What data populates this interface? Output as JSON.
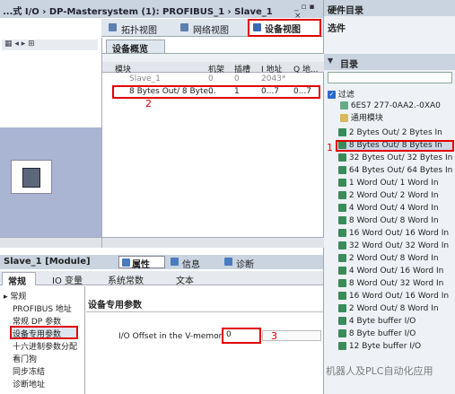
{
  "left_title": "...式 I/O  ›  DP-Mastersystem (1): PROFIBUS_1  ›  Slave_1",
  "win_ctrl": "_ ▫ ▪ ×",
  "view_tabs": [
    "拓扑视图",
    "网络视图",
    "设备视图"
  ],
  "overview_tab": "设备概览",
  "cols": [
    "模块",
    "机架",
    "插槽",
    "I 地址",
    "Q 地..."
  ],
  "rows": [
    {
      "module": "Slave_1",
      "rack": "0",
      "slot": "0",
      "i": "2043*",
      "q": ""
    },
    {
      "module": "8 Bytes Out/ 8 Byte...",
      "rack": "0",
      "slot": "1",
      "i": "0...7",
      "q": "0...7"
    }
  ],
  "marks": [
    "1",
    "2",
    "3"
  ],
  "module_title": "Slave_1 [Module]",
  "prop_tabs": [
    "属性",
    "信息",
    "诊断"
  ],
  "sub_tabs": [
    "常规",
    "IO 变量",
    "系统常数",
    "文本"
  ],
  "nav": [
    "▸ 常规",
    "PROFIBUS 地址",
    "常规 DP 参数",
    "设备专用参数",
    "十六进制参数分配",
    "看门狗",
    "同步冻结",
    "诊断地址"
  ],
  "section_title": "设备专用参数",
  "field_label": "I/O Offset in the V-memory:",
  "field_value": "0",
  "right_title": "硬件目录",
  "options": "选件",
  "catalog": "目录",
  "filter": "过滤",
  "catalog_items": [
    "6ES7 277-0AA2.-0XA0",
    "通用模块",
    "2 Bytes Out/ 2 Bytes In",
    "8 Bytes Out/ 8 Bytes In",
    "32 Bytes Out/ 32 Bytes In",
    "64 Bytes Out/ 64 Bytes In",
    "1 Word Out/ 1 Word In",
    "2 Word Out/ 2 Word In",
    "4 Word Out/ 4 Word In",
    "8 Word Out/ 8 Word In",
    "16 Word Out/ 16 Word In",
    "32 Word Out/ 32 Word In",
    "2 Word Out/ 8 Word In",
    "4 Word Out/ 16 Word In",
    "8 Word Out/ 32 Word In",
    "16 Word Out/ 16 Word In",
    "2 Word Out/ 8 Word In",
    "4 Byte buffer I/O",
    "8 Byte buffer I/O",
    "12 Byte buffer I/O"
  ],
  "watermark": "机器人及PLC自动化应用"
}
